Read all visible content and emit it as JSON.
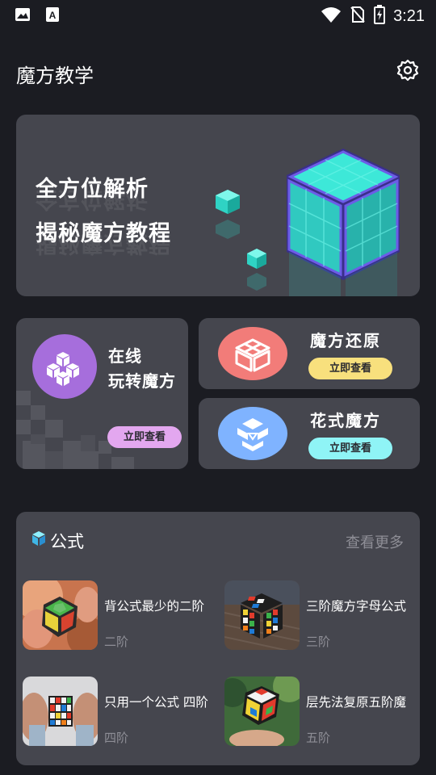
{
  "status_bar": {
    "time": "3:21",
    "left_icons": [
      "image-icon",
      "text-a-icon"
    ],
    "right_icons": [
      "wifi-icon",
      "no-sim-icon",
      "battery-charging-icon"
    ]
  },
  "header": {
    "title": "魔方教学",
    "settings_icon": "gear-icon"
  },
  "banner": {
    "line1": "全方位解析",
    "line2": "揭秘魔方教程"
  },
  "cards": {
    "online": {
      "title_line1": "在线",
      "title_line2": "玩转魔方",
      "button": "立即查看",
      "accent": "#a66edc",
      "button_color": "#e3a7ef"
    },
    "restore": {
      "title": "魔方还原",
      "button": "立即查看",
      "accent": "#f27c79",
      "button_color": "#f8e07d"
    },
    "fancy": {
      "title": "花式魔方",
      "button": "立即查看",
      "accent": "#7fb3ff",
      "button_color": "#8ff4f6"
    }
  },
  "formula": {
    "title": "公式",
    "view_more": "查看更多",
    "items": [
      {
        "title": "背公式最少的二阶",
        "tag": "二阶"
      },
      {
        "title": "三阶魔方字母公式",
        "tag": "三阶"
      },
      {
        "title": "只用一个公式 四阶",
        "tag": "四阶"
      },
      {
        "title": "层先法复原五阶魔",
        "tag": "五阶"
      }
    ]
  },
  "colors": {
    "background": "#1b1c22",
    "card": "#45464e",
    "muted_text": "#8e8e96",
    "hero_cube": "#3de8d8"
  }
}
